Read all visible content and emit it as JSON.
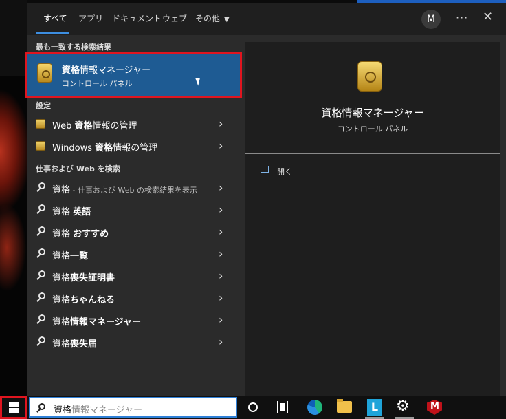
{
  "tabs": [
    {
      "label": "すべて"
    },
    {
      "label": "アプリ"
    },
    {
      "label": "ドキュメント"
    },
    {
      "label": "ウェブ"
    },
    {
      "label": "その他"
    }
  ],
  "more_caret": "▼",
  "account": {
    "initial": "M"
  },
  "window_controls": {
    "more": "···",
    "close": "✕"
  },
  "best_match": {
    "heading": "最も一致する検索結果",
    "title_bold": "資格",
    "title_rest": "情報マネージャー",
    "subtitle": "コントロール パネル",
    "icon": "vault-safe-icon"
  },
  "settings": {
    "heading": "設定",
    "items": [
      {
        "pre": "Web ",
        "bold": "資格",
        "post": "情報の管理",
        "icon": "vault-safe-icon"
      },
      {
        "pre": "Windows ",
        "bold": "資格",
        "post": "情報の管理",
        "icon": "vault-safe-icon"
      }
    ]
  },
  "web_search": {
    "heading": "仕事および Web を検索",
    "items": [
      {
        "normal": "資格",
        "bold": "",
        "hint": " - 仕事および Web の検索結果を表示"
      },
      {
        "normal": "資格 ",
        "bold": "英語",
        "hint": ""
      },
      {
        "normal": "資格 ",
        "bold": "おすすめ",
        "hint": ""
      },
      {
        "normal": "資格",
        "bold": "一覧",
        "hint": ""
      },
      {
        "normal": "資格",
        "bold": "喪失証明書",
        "hint": ""
      },
      {
        "normal": "資格",
        "bold": "ちゃんねる",
        "hint": ""
      },
      {
        "normal": "資格",
        "bold": "情報マネージャー",
        "hint": ""
      },
      {
        "normal": "資格",
        "bold": "喪失届",
        "hint": ""
      }
    ]
  },
  "preview": {
    "title": "資格情報マネージャー",
    "subtitle": "コントロール パネル",
    "open_label": "開く"
  },
  "searchbox": {
    "typed": "資格",
    "suggestion": "情報マネージャー"
  },
  "taskbar_icons": [
    "windows-start-icon",
    "cortana-icon",
    "task-view-icon",
    "edge-icon",
    "file-explorer-icon",
    "l-app-icon",
    "settings-gear-icon",
    "mcafee-icon"
  ],
  "colors": {
    "accent": "#1e5b93",
    "highlight_outline": "#e0151f",
    "tab_underline": "#3d8ee0"
  }
}
